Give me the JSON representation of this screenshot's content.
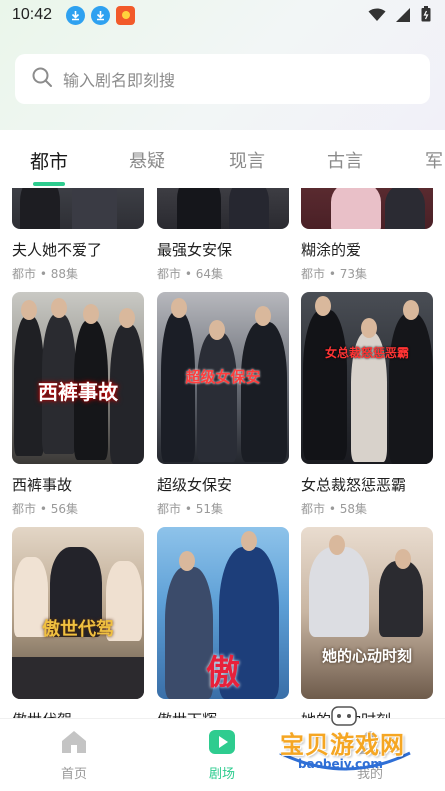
{
  "status_bar": {
    "time": "10:42"
  },
  "search": {
    "placeholder": "输入剧名即刻搜"
  },
  "tabs": [
    {
      "label": "都市",
      "active": true
    },
    {
      "label": "悬疑",
      "active": false
    },
    {
      "label": "现言",
      "active": false
    },
    {
      "label": "古言",
      "active": false
    },
    {
      "label": "军",
      "active": false
    }
  ],
  "dramas": [
    {
      "title": "夫人她不爱了",
      "meta": "都市 • 88集"
    },
    {
      "title": "最强女安保",
      "meta": "都市 • 64集"
    },
    {
      "title": "糊涂的爱",
      "meta": "都市 • 73集"
    },
    {
      "title": "西裤事故",
      "meta": "都市 • 56集",
      "poster_text": "西裤事故"
    },
    {
      "title": "超级女保安",
      "meta": "都市 • 51集",
      "poster_text": "超级女保安"
    },
    {
      "title": "女总裁怒惩恶霸",
      "meta": "都市 • 58集",
      "poster_text": "女总裁怒惩恶霸"
    },
    {
      "title": "傲世代驾",
      "meta": "",
      "poster_text": "傲世代驾"
    },
    {
      "title": "傲世下辉",
      "meta": "",
      "poster_text": "傲"
    },
    {
      "title": "她的心动时刻",
      "meta": "",
      "poster_text": "她的心动时刻"
    }
  ],
  "bottom_nav": [
    {
      "label": "首页",
      "icon": "home-icon",
      "active": false
    },
    {
      "label": "剧场",
      "icon": "play-icon",
      "active": true
    },
    {
      "label": "我的",
      "icon": "profile-icon",
      "active": false
    }
  ],
  "watermark": {
    "title": "宝贝游戏网",
    "url": "baobeiy.com"
  },
  "colors": {
    "accent": "#2ecc8f",
    "text_primary": "#1f1f1f",
    "text_secondary": "#9a9a9a"
  }
}
